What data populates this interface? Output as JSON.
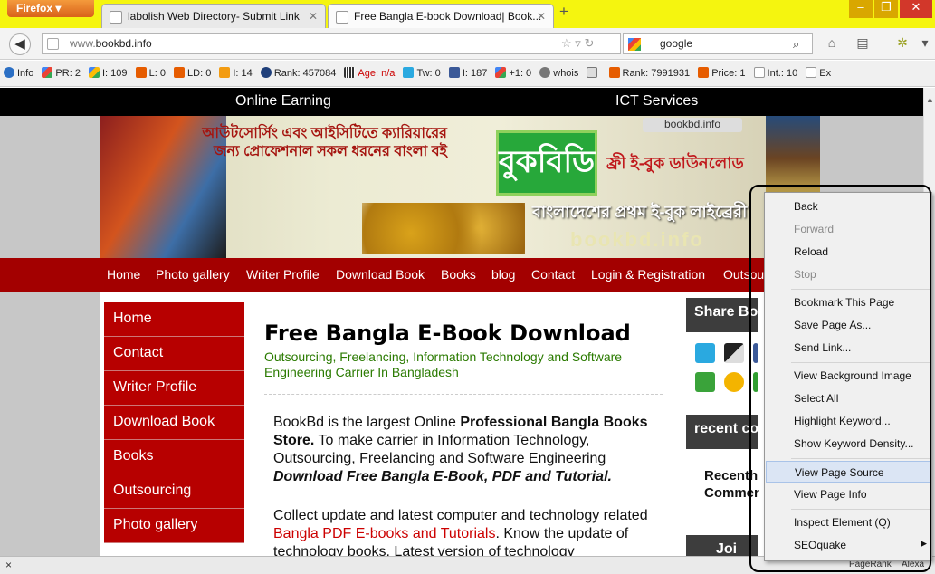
{
  "browser": {
    "menu_button": "Firefox",
    "tabs": [
      {
        "title": "labolish Web Directory- Submit Link"
      },
      {
        "title": "Free Bangla E-book Download| Book..."
      }
    ],
    "new_tab": "+",
    "window_controls": {
      "minimize": "–",
      "maximize": "❐",
      "close": "✕"
    },
    "url": "www.bookbd.info",
    "url_prefix": "www.",
    "url_domain": "bookbd.info",
    "search_placeholder": "google"
  },
  "seoquake": {
    "items": [
      {
        "icon": "info-icon",
        "text": "Info"
      },
      {
        "icon": "pr-icon",
        "text": "PR: 2"
      },
      {
        "icon": "google-index-icon",
        "text": "I: 109"
      },
      {
        "icon": "links-icon",
        "text": "L: 0"
      },
      {
        "icon": "ld-icon",
        "text": "LD: 0"
      },
      {
        "icon": "bing-index-icon",
        "text": "I: 14"
      },
      {
        "icon": "alexa-rank-icon",
        "text": "Rank: 457084"
      },
      {
        "icon": "age-icon",
        "text": "Age: n/a"
      },
      {
        "icon": "twitter-icon",
        "text": "Tw: 0"
      },
      {
        "icon": "facebook-icon",
        "text": "I: 187"
      },
      {
        "icon": "gplus-icon",
        "text": "+1: 0"
      },
      {
        "icon": "whois-icon",
        "text": "whois"
      },
      {
        "icon": "source-icon",
        "text": ""
      },
      {
        "icon": "semrush-rank-icon",
        "text": "Rank: 7991931"
      },
      {
        "icon": "price-icon",
        "text": "Price: 1"
      },
      {
        "icon": "internal-links-icon",
        "text": "Int.: 10"
      },
      {
        "icon": "external-links-icon",
        "text": "Ex"
      }
    ]
  },
  "site": {
    "top_nav": [
      "Online Earning",
      "ICT Services"
    ],
    "banner": {
      "tagline": "আউটসোর্সিং এবং আইসিটিতে ক্যারিয়ারের জন্য প্রোফেশনাল সকল ধরনের বাংলা বই",
      "logo_text": "বুকবিডি",
      "url_tag": "bookbd.info",
      "free_ebook": "ফ্রী ই-বুক ডাউনলোড",
      "library": "বাংলাদেশের প্রথম ই-বুক লাইব্রেরী",
      "watermark": "bookbd.info"
    },
    "main_nav": [
      "Home",
      "Photo gallery",
      "Writer Profile",
      "Download Book",
      "Books",
      "blog",
      "Contact",
      "Login & Registration",
      "Outsou"
    ],
    "sidebar": [
      "Home",
      "Contact",
      "Writer Profile",
      "Download Book",
      "Books",
      "Outsourcing",
      "Photo gallery"
    ],
    "title": "Free Bangla E-Book Download",
    "subtitle": "Outsourcing, Freelancing, Information Technology and Software Engineering Carrier In Bangladesh",
    "para1": {
      "a": "BookBd is the largest Online ",
      "b": "Professional Bangla Books Store.",
      "c": " To make carrier in Information Technology, Outsourcing, Freelancing and Software Engineering ",
      "d": "Download Free Bangla E-Book, PDF and Tutorial."
    },
    "para2": {
      "a": "Collect update and latest computer and technology related ",
      "link": "Bangla PDF E-books and Tutorials",
      "b": ". Know the update of technology books. Latest version of technology"
    },
    "share_heading": "Share Bo",
    "recent_heading": "recent co",
    "recent_text": "Recenth Commer",
    "join_heading": "Joi"
  },
  "context_menu": {
    "items": [
      {
        "label": "Back",
        "enabled": true
      },
      {
        "label": "Forward",
        "enabled": false
      },
      {
        "label": "Reload",
        "enabled": true
      },
      {
        "label": "Stop",
        "enabled": false
      },
      {
        "label": "Bookmark This Page",
        "enabled": true
      },
      {
        "label": "Save Page As...",
        "enabled": true
      },
      {
        "label": "Send Link...",
        "enabled": true
      },
      {
        "label": "View Background Image",
        "enabled": true
      },
      {
        "label": "Select All",
        "enabled": true
      },
      {
        "label": "Highlight Keyword...",
        "enabled": true
      },
      {
        "label": "Show Keyword Density...",
        "enabled": true
      },
      {
        "label": "View Page Source",
        "enabled": true,
        "highlighted": true
      },
      {
        "label": "View Page Info",
        "enabled": true
      },
      {
        "label": "Inspect Element (Q)",
        "enabled": true
      },
      {
        "label": "SEOquake",
        "enabled": true,
        "submenu": true
      }
    ]
  },
  "statusbar": {
    "close": "×",
    "pagerank": "PageRank",
    "alexa": "Alexa"
  },
  "colors": {
    "titlebar": "#f5f50f",
    "firefox_button": "#e07528",
    "site_red": "#b70000",
    "nav_red": "#a30000",
    "subtitle_green": "#2a7a00",
    "link_red": "#cc0000"
  }
}
